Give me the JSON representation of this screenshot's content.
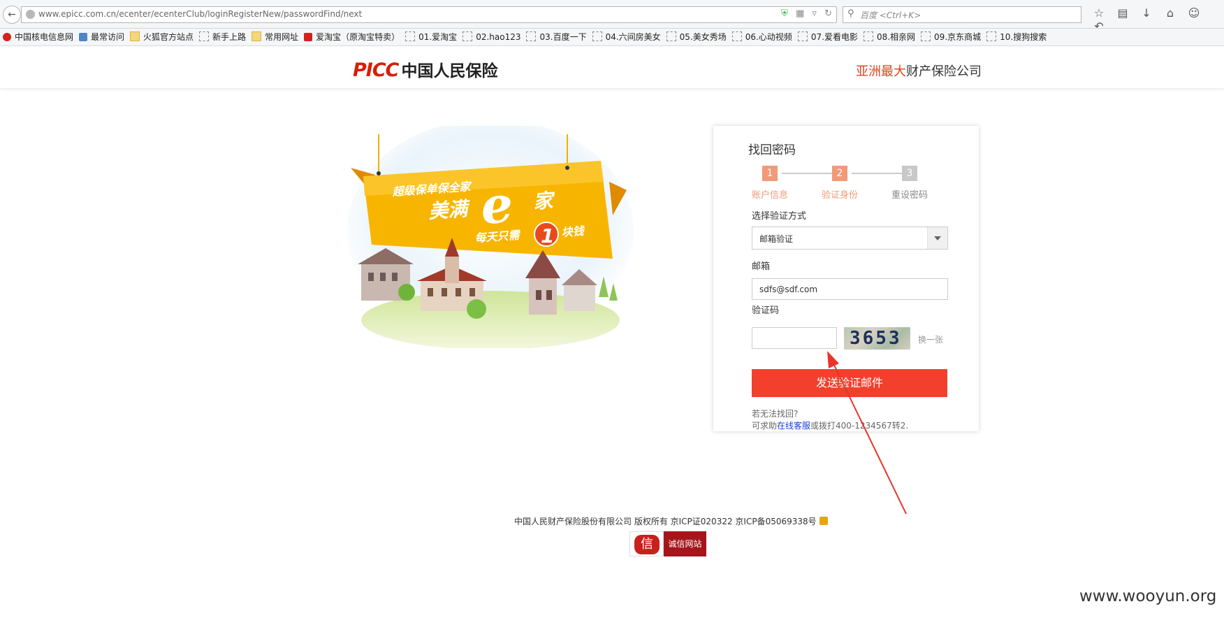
{
  "browser": {
    "url": "www.epicc.com.cn/ecenter/ecenterClub/loginRegisterNew/passwordFind/next",
    "search_placeholder": "百度 <Ctrl+K>",
    "bookmarks": [
      "中国核电信息网",
      "最常访问",
      "火狐官方站点",
      "新手上路",
      "常用网址",
      "爱淘宝（原淘宝特卖）",
      "01.爱淘宝",
      "02.hao123",
      "03.百度一下",
      "04.六间房美女",
      "05.美女秀场",
      "06.心动视频",
      "07.爱看电影",
      "08.相亲网",
      "09.京东商城",
      "10.搜狗搜索"
    ],
    "bookmark_icons": [
      "red",
      "blue",
      "folder",
      "dashed",
      "folder",
      "redsq",
      "dashed",
      "dashed",
      "dashed",
      "dashed",
      "dashed",
      "dashed",
      "dashed",
      "dashed",
      "dashed",
      "dashed"
    ]
  },
  "header": {
    "logo_en": "PICC",
    "logo_cn": "中国人民保险",
    "tagline_red": "亚洲最大",
    "tagline_dark": "财产保险公司"
  },
  "banner": {
    "line1": "超级保单保全家",
    "line2a": "美满",
    "line2e": "e",
    "line2b": "家",
    "line3a": "每天只需",
    "line3num": "1",
    "line3b": "块钱"
  },
  "form": {
    "title": "找回密码",
    "steps": [
      {
        "num": "1",
        "label": "账户信息",
        "state": "done"
      },
      {
        "num": "2",
        "label": "验证身份",
        "state": "active"
      },
      {
        "num": "3",
        "label": "重设密码",
        "state": "pending"
      }
    ],
    "method_label": "选择验证方式",
    "method_value": "邮箱验证",
    "email_label": "邮箱",
    "email_value": "sdfs@sdf.com",
    "captcha_label": "验证码",
    "captcha_value": "",
    "captcha_image_text": "3653",
    "refresh_label": "换一张",
    "submit_label": "发送验证邮件",
    "help_line1": "若无法找回?",
    "help_line2_prefix": "可求助",
    "help_link": "在线客服",
    "help_line2_suffix": "或拨打400-1234567转2."
  },
  "colors": {
    "accent": "#f2402d",
    "step_active": "#f09a7a",
    "step_pending": "#c8c8c8",
    "link": "#1a3fd6"
  },
  "footer": {
    "copyright": "中国人民财产保险股份有限公司 版权所有 京ICP证020322 京ICP备05069338号",
    "badge_icon_text": "信",
    "badge_text": "诚信网站"
  },
  "watermark": "www.wooyun.org"
}
